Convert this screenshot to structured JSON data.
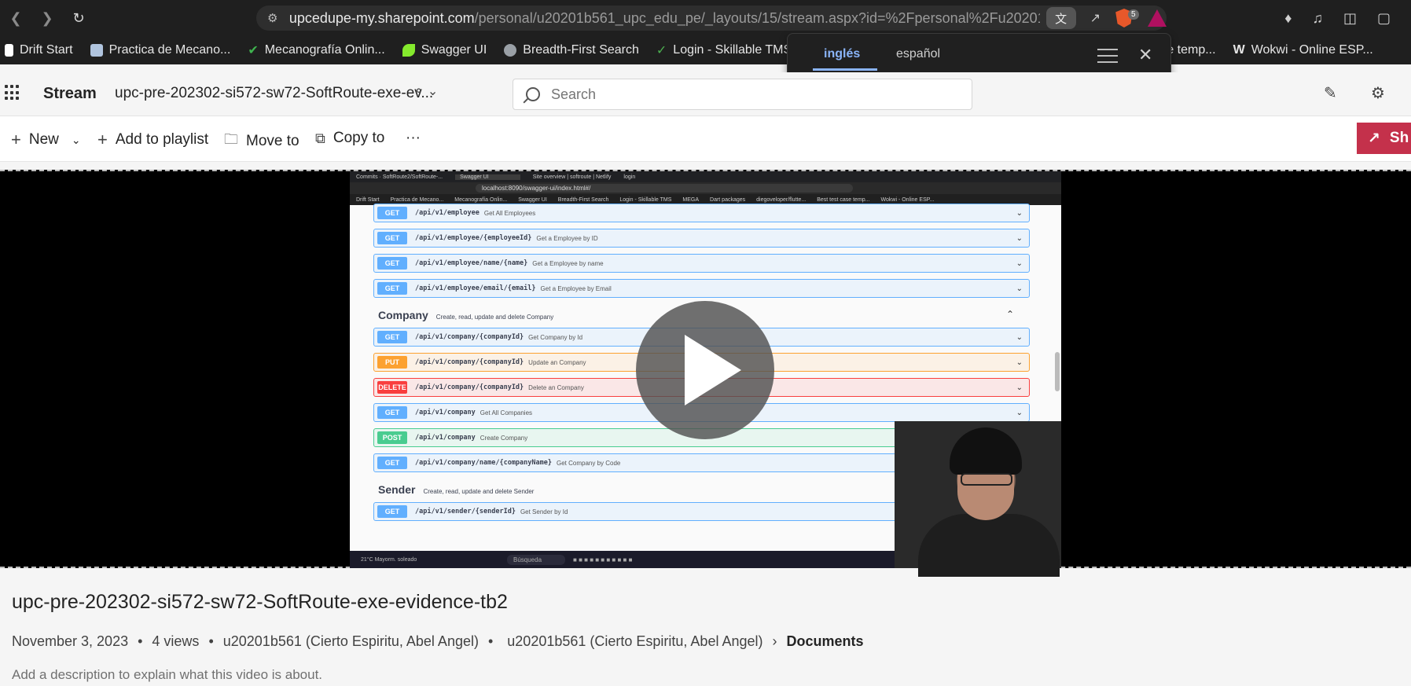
{
  "browser": {
    "url_host": "upcedupe-my.sharepoint.com",
    "url_path": "/personal/u20201b561_upc_edu_pe/_layouts/15/stream.aspx?id=%2Fpersonal%2Fu20201...",
    "brave_badge": "5"
  },
  "bookmarks": [
    {
      "label": "Drift Start",
      "icon": "document-icon",
      "color": "#ffffff"
    },
    {
      "label": "Practica de Mecano...",
      "icon": "document-icon",
      "color": "#b0c4de"
    },
    {
      "label": "Mecanografía Onlin...",
      "icon": "check-icon",
      "color": "#3fb34f"
    },
    {
      "label": "Swagger UI",
      "icon": "swagger-icon",
      "color": "#85ea2d"
    },
    {
      "label": "Breadth-First Search",
      "icon": "globe-icon",
      "color": "#9aa0a6"
    },
    {
      "label": "Login - Skillable TMS",
      "icon": "check-icon",
      "color": "#4caf50"
    },
    {
      "label": "test case temp...",
      "icon": "",
      "color": ""
    },
    {
      "label": "Wokwi - Online ESP...",
      "icon": "wokwi-icon",
      "color": "#ffffff"
    }
  ],
  "translate_popup": {
    "tab_source": "inglés",
    "tab_target": "español"
  },
  "stream": {
    "app_title": "Stream",
    "doc_title": "upc-pre-202302-si572-sw72-SoftRoute-exe-ev...",
    "search_placeholder": "Search"
  },
  "commands": {
    "new": "New",
    "add_to_playlist": "Add to playlist",
    "move_to": "Move to",
    "copy_to": "Copy to",
    "more": "···",
    "share": "Sh"
  },
  "inner_screenshot": {
    "tabs": [
      "Commits · SoftRoute2/SoftRoute-...",
      "Swagger UI",
      "Site overview | softroute | Netlify",
      "login"
    ],
    "url": "localhost:8090/swagger-ui/index.html#/",
    "bookmarks": [
      "Drift Start",
      "Practica de Mecano...",
      "Mecanografía Onlin...",
      "Swagger UI",
      "Breadth-First Search",
      "Login - Skillable TMS",
      "MEGA",
      "Dart packages",
      "diegoveloper/flutte...",
      "Best test case temp...",
      "Wokwi - Online ESP..."
    ],
    "ops_top": [
      {
        "method": "GET",
        "path": "/api/v1/employee",
        "summary": "Get All Employees",
        "kind": "get"
      },
      {
        "method": "GET",
        "path": "/api/v1/employee/{employeeId}",
        "summary": "Get a Employee by ID",
        "kind": "get"
      },
      {
        "method": "GET",
        "path": "/api/v1/employee/name/{name}",
        "summary": "Get a Employee by name",
        "kind": "get"
      },
      {
        "method": "GET",
        "path": "/api/v1/employee/email/{email}",
        "summary": "Get a Employee by Email",
        "kind": "get"
      }
    ],
    "section_company": {
      "name": "Company",
      "desc": "Create, read, update and delete Company"
    },
    "ops_company": [
      {
        "method": "GET",
        "path": "/api/v1/company/{companyId}",
        "summary": "Get Company by Id",
        "kind": "get"
      },
      {
        "method": "PUT",
        "path": "/api/v1/company/{companyId}",
        "summary": "Update an Company",
        "kind": "put"
      },
      {
        "method": "DELETE",
        "path": "/api/v1/company/{companyId}",
        "summary": "Delete an Company",
        "kind": "delete"
      },
      {
        "method": "GET",
        "path": "/api/v1/company",
        "summary": "Get All Companies",
        "kind": "get"
      },
      {
        "method": "POST",
        "path": "/api/v1/company",
        "summary": "Create Company",
        "kind": "post"
      },
      {
        "method": "GET",
        "path": "/api/v1/company/name/{companyName}",
        "summary": "Get Company by Code",
        "kind": "get"
      }
    ],
    "section_sender": {
      "name": "Sender",
      "desc": "Create, read, update and delete Sender"
    },
    "ops_sender": [
      {
        "method": "GET",
        "path": "/api/v1/sender/{senderId}",
        "summary": "Get Sender by Id",
        "kind": "get"
      }
    ],
    "taskbar_search": "Búsqueda",
    "weather": "21°C Mayorm. soleado"
  },
  "video": {
    "title": "upc-pre-202302-si572-sw72-SoftRoute-exe-evidence-tb2",
    "date": "November 3, 2023",
    "views": "4 views",
    "owner": "u20201b561 (Cierto Espiritu, Abel Angel)",
    "location_owner": "u20201b561 (Cierto Espiritu, Abel Angel)",
    "location_folder": "Documents",
    "description_placeholder": "Add a description to explain what this video is about."
  }
}
